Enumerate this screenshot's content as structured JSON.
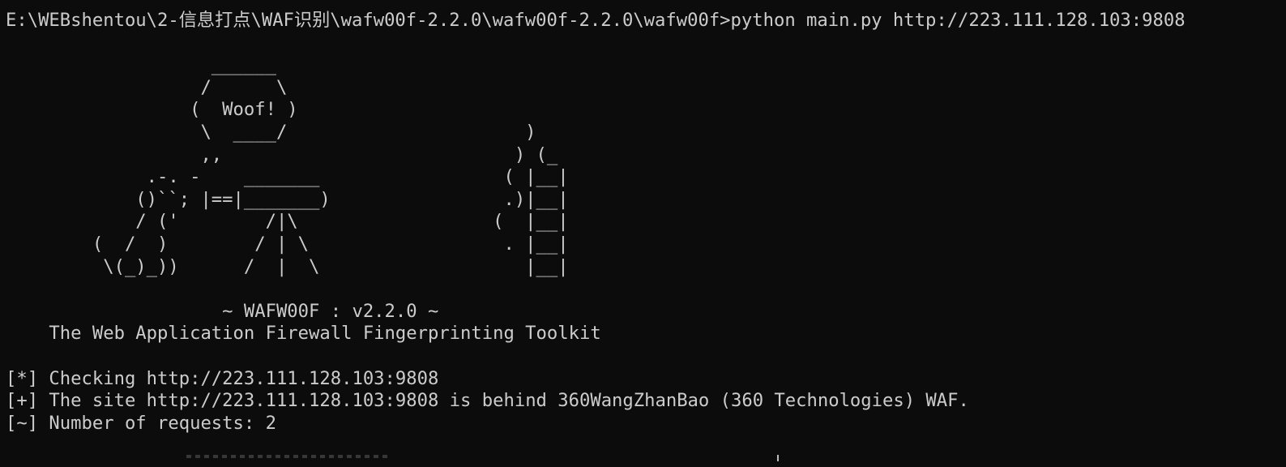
{
  "terminal": {
    "command_line": {
      "prompt": "E:\\WEBshentou\\2-信息打点\\WAF识别\\wafw00f-2.2.0\\wafw00f-2.2.0\\wafw00f>",
      "command": "python main.py http://223.111.128.103:9808"
    },
    "banner_art": [
      "",
      "                   ______",
      "                  /      \\",
      "                 (  Woof! )",
      "                  \\  ____/                      )",
      "                  ,,                           ) (_",
      "             .-. -    _______                 ( |__|",
      "            ()``; |==|_______)                .)|__|",
      "            / ('        /|\\                  (  |__|",
      "        (  /  )        / | \\                  . |__|",
      "         \\(_)_))      /  |  \\                   |__|",
      ""
    ],
    "version_line": "                    ~ WAFW00F : v2.2.0 ~",
    "toolkit_line": "    The Web Application Firewall Fingerprinting Toolkit",
    "output": [
      {
        "symbol": "[*]",
        "text": " Checking http://223.111.128.103:9808"
      },
      {
        "symbol": "[+]",
        "text": " The site http://223.111.128.103:9808 is behind 360WangZhanBao (360 Technologies) WAF."
      },
      {
        "symbol": "[~]",
        "text": " Number of requests: 2"
      }
    ]
  },
  "colors": {
    "background": "#0c0c0c",
    "foreground": "#cccccc"
  }
}
